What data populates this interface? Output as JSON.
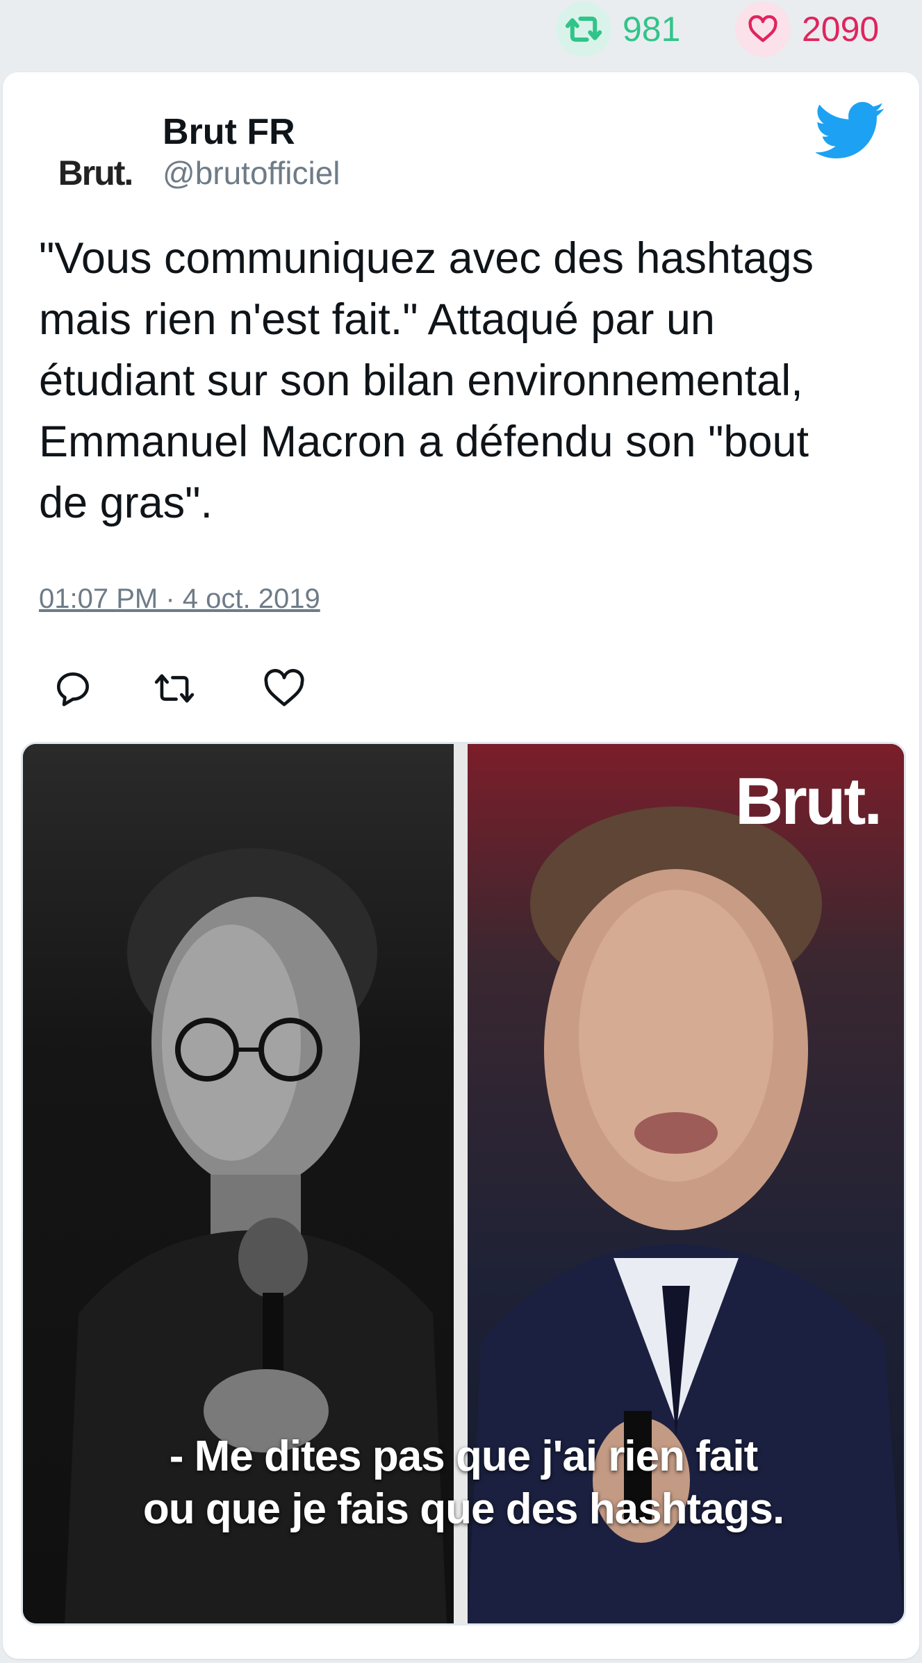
{
  "stats": {
    "retweets": "981",
    "likes": "2090",
    "retweet_color": "#31c48a",
    "like_color": "#e0245e"
  },
  "account": {
    "avatar_text": "Brut.",
    "name": "Brut FR",
    "handle": "@brutofficiel"
  },
  "tweet": {
    "text": "\"Vous communiquez avec des hashtags\nmais rien n'est fait.\" Attaqué par un\nétudiant sur son bilan environnemental,\nEmmanuel Macron a défendu son \"bout\nde gras\".",
    "timestamp": "01:07 PM · 4 oct. 2019"
  },
  "actions": [
    "reply-icon",
    "retweet-icon",
    "like-icon"
  ],
  "media": {
    "watermark": "Brut.",
    "subtitle_line1": "- Me dites pas que j'ai rien fait",
    "subtitle_line2": "ou que je fais que des hashtags."
  },
  "colors": {
    "twitter_blue": "#1da1f2",
    "text": "#0f1419",
    "secondary": "#6e7b87"
  }
}
